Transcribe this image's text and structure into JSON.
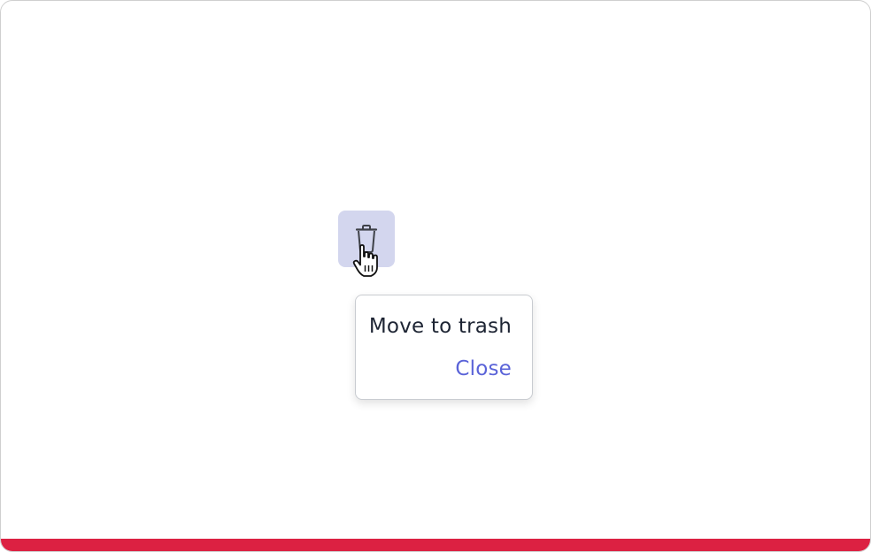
{
  "trash_button": {
    "icon": "trash-icon",
    "background": "#d3d6ee"
  },
  "cursor": {
    "icon": "hand-pointer-icon"
  },
  "popover": {
    "title": "Move to trash",
    "close_label": "Close"
  },
  "colors": {
    "accent": "#5a63d8",
    "bottom_bar": "#dc2142",
    "text": "#1d2433"
  }
}
